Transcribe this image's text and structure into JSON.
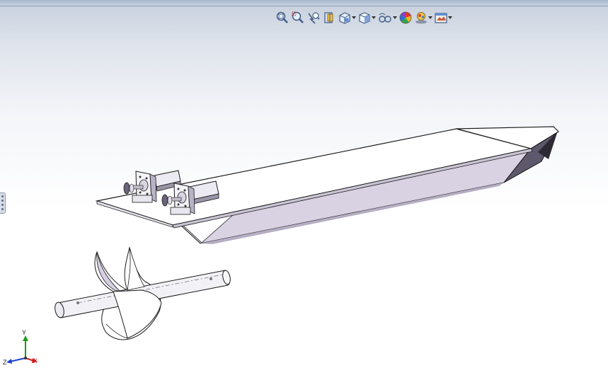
{
  "toolbar": {
    "items": [
      {
        "name": "zoom-to-fit-icon",
        "has_dropdown": false
      },
      {
        "name": "zoom-to-area-icon",
        "has_dropdown": false
      },
      {
        "name": "previous-view-icon",
        "has_dropdown": false
      },
      {
        "name": "section-view-icon",
        "has_dropdown": false
      },
      {
        "name": "view-orientation-icon",
        "has_dropdown": true
      },
      {
        "name": "display-style-icon",
        "has_dropdown": true
      },
      {
        "name": "hide-show-items-icon",
        "has_dropdown": true
      },
      {
        "name": "edit-appearance-icon",
        "has_dropdown": false
      },
      {
        "name": "apply-scene-icon",
        "has_dropdown": true
      },
      {
        "name": "view-settings-icon",
        "has_dropdown": true
      }
    ]
  },
  "triad": {
    "x_label": "X",
    "y_label": "Y",
    "z_label": "Z",
    "x_color": "#d11d1d",
    "y_color": "#1b9a1b",
    "z_color": "#1d3fd1"
  },
  "colors": {
    "part_face": "#ffffff",
    "part_edge": "#1a1a1a",
    "part_side": "#dcd8e6",
    "part_shadow": "#6b6578"
  }
}
